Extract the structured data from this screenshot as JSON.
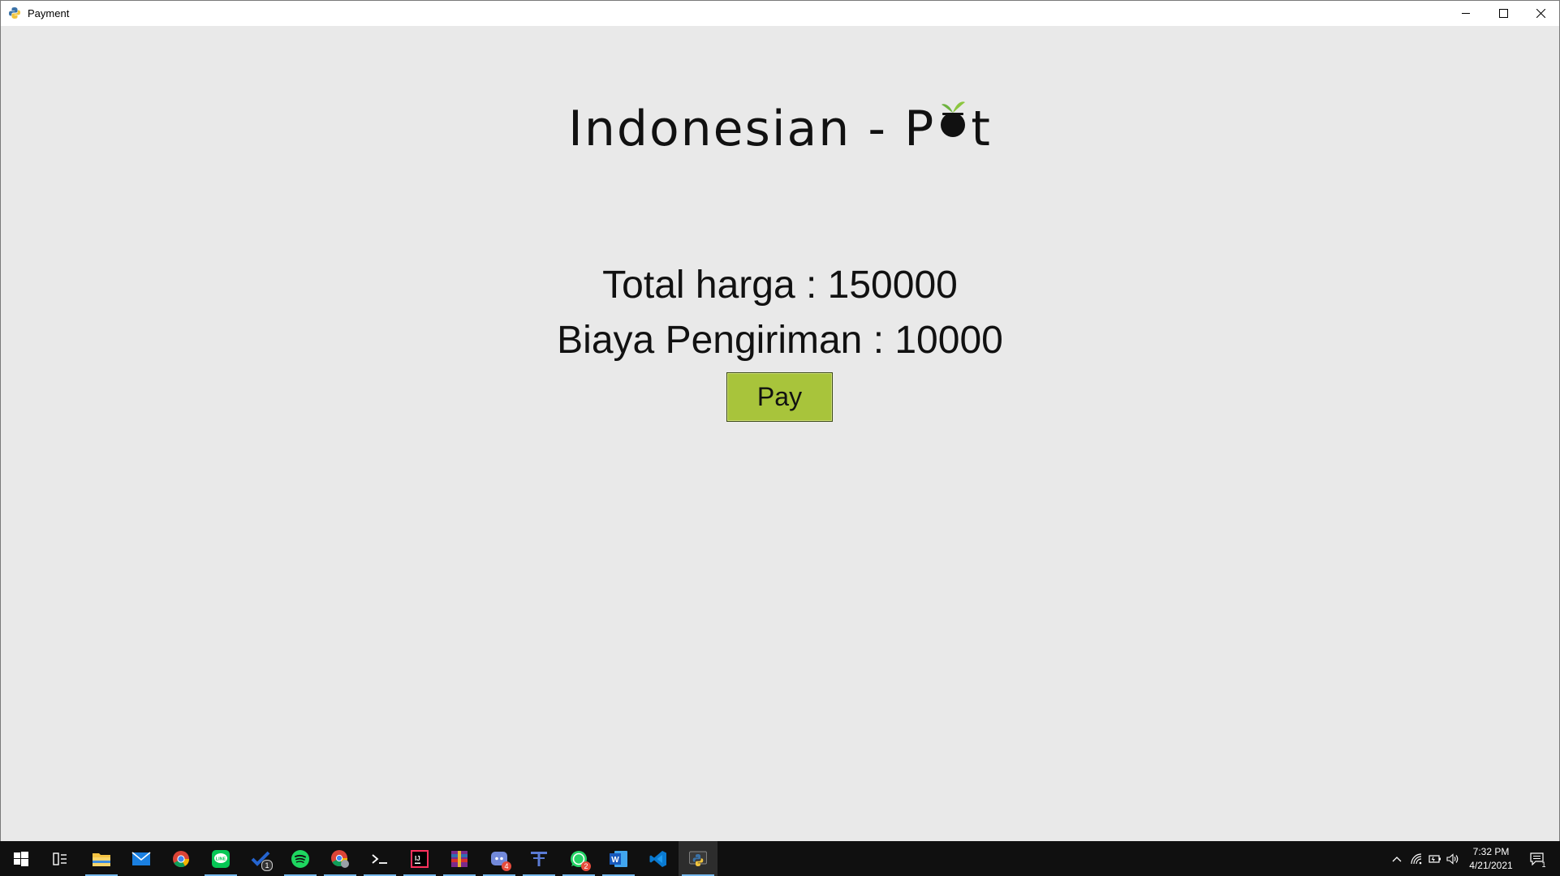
{
  "window": {
    "title": "Payment"
  },
  "app": {
    "brand_prefix": "Indonesian - P",
    "brand_suffix": "t",
    "total_label": "Total harga : 150000",
    "shipping_label": "Biaya Pengiriman : 10000",
    "pay_label": "Pay",
    "accent_color": "#a8c43b"
  },
  "taskbar": {
    "apps": [
      {
        "name": "start-icon"
      },
      {
        "name": "task-view-icon"
      },
      {
        "name": "file-explorer-icon"
      },
      {
        "name": "mail-icon"
      },
      {
        "name": "chrome-icon"
      },
      {
        "name": "line-icon"
      },
      {
        "name": "todo-icon",
        "badge": "1"
      },
      {
        "name": "spotify-icon"
      },
      {
        "name": "chrome-profile-icon"
      },
      {
        "name": "terminal-icon"
      },
      {
        "name": "intellij-icon"
      },
      {
        "name": "winrar-icon"
      },
      {
        "name": "discord-icon",
        "badge": "4"
      },
      {
        "name": "typora-icon"
      },
      {
        "name": "whatsapp-icon",
        "badge": "2"
      },
      {
        "name": "word-icon"
      },
      {
        "name": "vscode-icon"
      },
      {
        "name": "python-icon"
      }
    ],
    "clock_time": "7:32 PM",
    "clock_date": "4/21/2021",
    "notification_count": "1"
  }
}
